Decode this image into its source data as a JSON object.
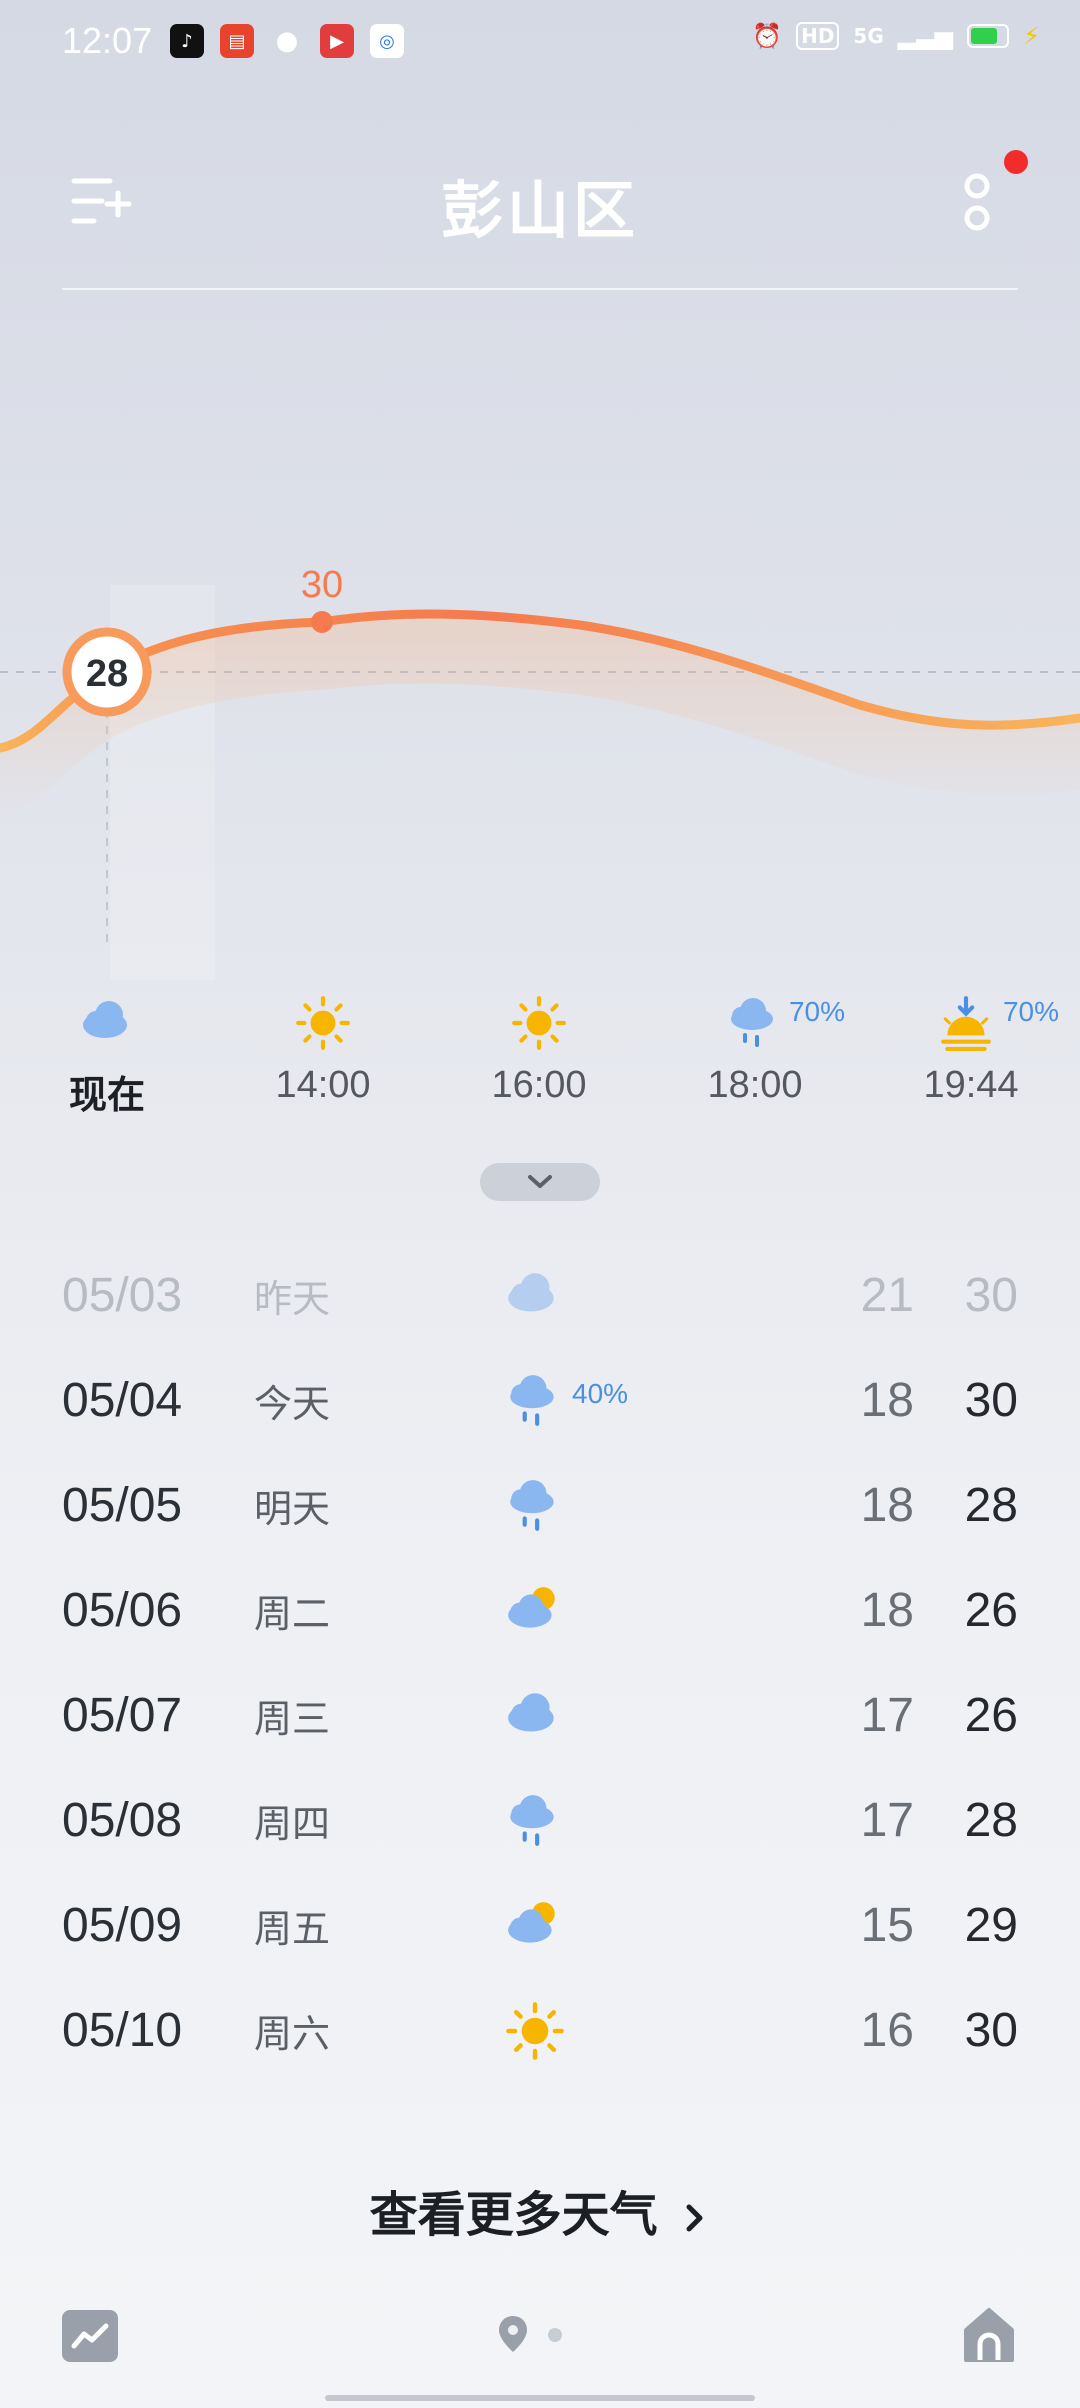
{
  "status_bar": {
    "time": "12:07",
    "network": "5G",
    "hd": "HD"
  },
  "header": {
    "title": "彭山区"
  },
  "chart": {
    "current_temp": "28",
    "peak_temp": "30"
  },
  "chart_data": {
    "type": "line",
    "title": "",
    "xlabel": "",
    "ylabel": "",
    "categories": [
      "现在",
      "14:00",
      "16:00",
      "18:00",
      "19:44"
    ],
    "values": [
      28,
      30,
      30,
      29,
      28
    ],
    "annotations": [
      "28",
      "30"
    ]
  },
  "hourly": [
    {
      "label": "现在",
      "icon": "cloud-icon",
      "precip": ""
    },
    {
      "label": "14:00",
      "icon": "sun-icon",
      "precip": ""
    },
    {
      "label": "16:00",
      "icon": "sun-icon",
      "precip": ""
    },
    {
      "label": "18:00",
      "icon": "rain-icon",
      "precip": "70%"
    },
    {
      "label": "19:44",
      "icon": "sunset-icon",
      "precip": "70%"
    }
  ],
  "daily": [
    {
      "date": "05/03",
      "name": "昨天",
      "icon": "cloud-icon",
      "precip": "",
      "low": "21",
      "high": "30"
    },
    {
      "date": "05/04",
      "name": "今天",
      "icon": "rain-icon",
      "precip": "40%",
      "low": "18",
      "high": "30"
    },
    {
      "date": "05/05",
      "name": "明天",
      "icon": "rain-icon",
      "precip": "",
      "low": "18",
      "high": "28"
    },
    {
      "date": "05/06",
      "name": "周二",
      "icon": "partly-cloudy-icon",
      "precip": "",
      "low": "18",
      "high": "26"
    },
    {
      "date": "05/07",
      "name": "周三",
      "icon": "cloud-icon",
      "precip": "",
      "low": "17",
      "high": "26"
    },
    {
      "date": "05/08",
      "name": "周四",
      "icon": "rain-icon",
      "precip": "",
      "low": "17",
      "high": "28"
    },
    {
      "date": "05/09",
      "name": "周五",
      "icon": "partly-cloudy-icon",
      "precip": "",
      "low": "15",
      "high": "29"
    },
    {
      "date": "05/10",
      "name": "周六",
      "icon": "sun-icon",
      "precip": "",
      "low": "16",
      "high": "30"
    }
  ],
  "footer": {
    "more_weather": "查看更多天气"
  },
  "colors": {
    "accent_orange": "#f57a4e",
    "rain_blue": "#4a90e2",
    "sun_yellow": "#f7b500",
    "cloud_blue": "#8ab7ef"
  }
}
